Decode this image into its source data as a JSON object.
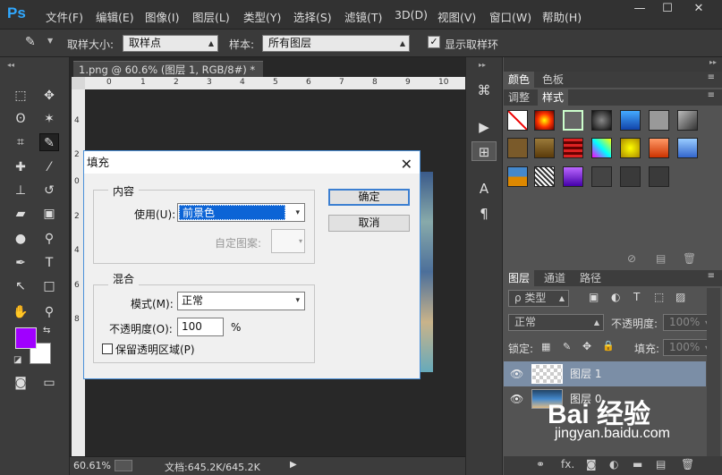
{
  "menubar": {
    "logo": "Ps",
    "items": [
      "文件(F)",
      "编辑(E)",
      "图像(I)",
      "图层(L)",
      "类型(Y)",
      "选择(S)",
      "滤镜(T)",
      "3D(D)",
      "视图(V)",
      "窗口(W)",
      "帮助(H)"
    ],
    "minimize": "—",
    "restore": "☐",
    "close": "✕"
  },
  "options": {
    "sample_size_label": "取样大小:",
    "sample_size_value": "取样点",
    "sample_label": "样本:",
    "sample_value": "所有图层",
    "show_ring_label": "显示取样环"
  },
  "document": {
    "tab_title": "1.png @ 60.6% (图层 1, RGB/8#) *",
    "tab_close": "×",
    "ruler_h_ticks": [
      "0",
      "1",
      "2",
      "3",
      "4",
      "5",
      "6",
      "7",
      "8",
      "9",
      "10"
    ],
    "ruler_v_ticks": [
      "4",
      "2",
      "0",
      "2",
      "4",
      "6",
      "8"
    ],
    "zoom": "60.61%",
    "doc_info": "文档:645.2K/645.2K"
  },
  "dialog": {
    "title": "填充",
    "close": "✕",
    "content_group": "内容",
    "use_label": "使用(U):",
    "use_value": "前景色",
    "custom_pattern_label": "自定图案:",
    "blend_group": "混合",
    "mode_label": "模式(M):",
    "mode_value": "正常",
    "opacity_label": "不透明度(O):",
    "opacity_value": "100",
    "opacity_unit": "%",
    "preserve_label": "保留透明区域(P)",
    "ok": "确定",
    "cancel": "取消"
  },
  "panels": {
    "tab_color": "颜色",
    "tab_swatches": "色板",
    "tab_adjust": "调整",
    "tab_styles": "样式",
    "tab_layers": "图层",
    "tab_channels": "通道",
    "tab_paths": "路径",
    "kind_label": "ρ 类型",
    "blend_mode": "正常",
    "opacity_label": "不透明度:",
    "opacity_value": "100%",
    "lock_label": "锁定:",
    "fill_label": "填充:",
    "fill_value": "100%",
    "layers": [
      {
        "name": "图层 1"
      },
      {
        "name": "图层 0"
      }
    ],
    "footer_fx": "fx."
  },
  "watermark": {
    "brand": "Bai 经验",
    "url": "jingyan.baidu.com"
  },
  "colors": {
    "foreground": "#a000ff",
    "background": "#ffffff",
    "dialog_accent": "#3c7fd1",
    "selected_field": "#0c64d6"
  }
}
